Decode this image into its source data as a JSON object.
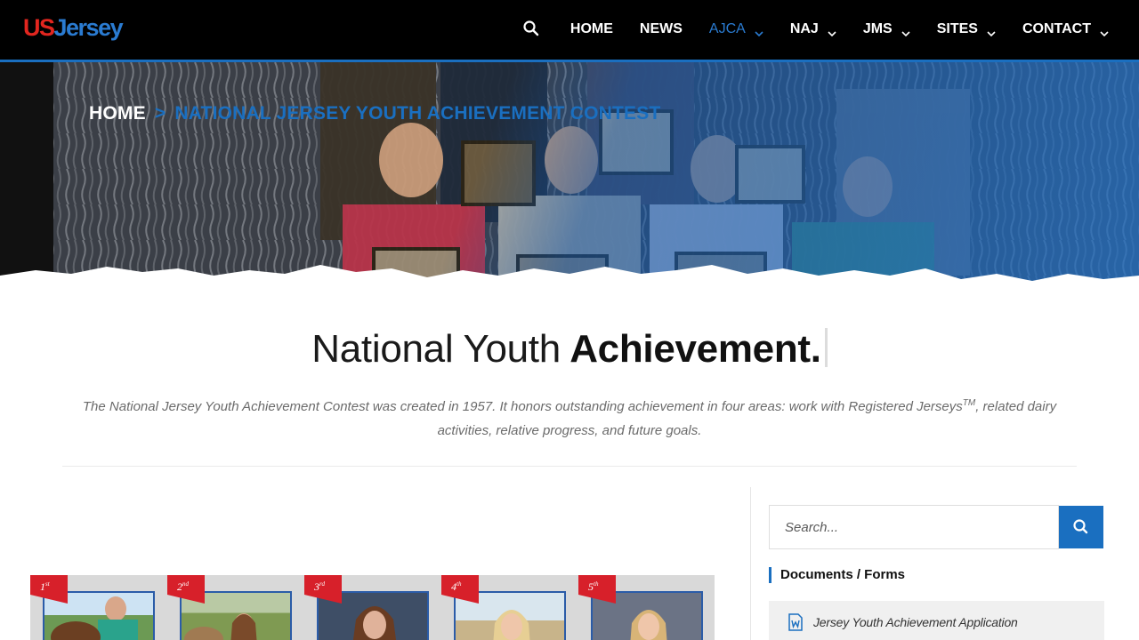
{
  "header": {
    "logo_us": "US",
    "logo_jersey": "Jersey",
    "nav": [
      {
        "label": "HOME",
        "dropdown": false,
        "active": false
      },
      {
        "label": "NEWS",
        "dropdown": false,
        "active": false
      },
      {
        "label": "AJCA",
        "dropdown": true,
        "active": true
      },
      {
        "label": "NAJ",
        "dropdown": true,
        "active": false
      },
      {
        "label": "JMS",
        "dropdown": true,
        "active": false
      },
      {
        "label": "SITES",
        "dropdown": true,
        "active": false
      },
      {
        "label": "CONTACT",
        "dropdown": true,
        "active": false
      }
    ],
    "search_icon": "search-icon"
  },
  "hero": {
    "breadcrumb_home": "HOME",
    "breadcrumb_sep": ">",
    "breadcrumb_current": "NATIONAL JERSEY YOUTH ACHIEVEMENT CONTEST"
  },
  "main": {
    "title_light": "National Youth",
    "title_bold": "Achievement.",
    "intro_text": "The National Jersey Youth Achievement Contest was created in 1957. It honors outstanding achievement in four areas: work with Registered Jerseys",
    "intro_tm": "TM",
    "intro_text_2": ", related dairy activities, relative progress, and future goals.",
    "awards": [
      {
        "place": "1",
        "suffix": "st"
      },
      {
        "place": "2",
        "suffix": "nd"
      },
      {
        "place": "3",
        "suffix": "rd"
      },
      {
        "place": "4",
        "suffix": "th"
      },
      {
        "place": "5",
        "suffix": "th"
      }
    ]
  },
  "sidebar": {
    "search_placeholder": "Search...",
    "widget_title": "Documents / Forms",
    "documents": [
      {
        "label": "Jersey Youth Achievement Application",
        "icon": "word-document-icon"
      }
    ]
  },
  "colors": {
    "brand_blue": "#1a6fc0",
    "brand_red": "#e2261f",
    "header_bg": "#000000"
  }
}
